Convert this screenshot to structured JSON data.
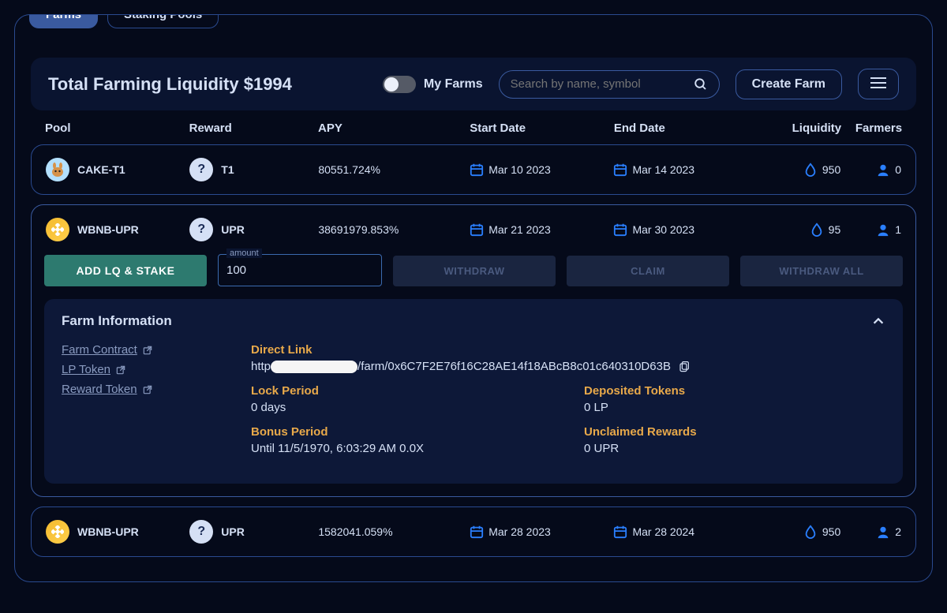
{
  "tabs": {
    "farms": "Farms",
    "staking": "Staking Pools"
  },
  "header": {
    "liquidity_label": "Total Farming Liquidity",
    "liquidity_value": "$1994",
    "my_farms": "My Farms",
    "search_placeholder": "Search by name, symbol",
    "create_farm": "Create Farm"
  },
  "columns": {
    "pool": "Pool",
    "reward": "Reward",
    "apy": "APY",
    "start": "Start Date",
    "end": "End Date",
    "liquidity": "Liquidity",
    "farmers": "Farmers"
  },
  "rows": [
    {
      "pool_icon": "cake",
      "pool": "CAKE-T1",
      "reward_icon": "unknown",
      "reward": "T1",
      "apy": "80551.724%",
      "start": "Mar 10 2023",
      "end": "Mar 14 2023",
      "liquidity": "950",
      "farmers": "0",
      "expanded": false
    },
    {
      "pool_icon": "wbnb",
      "pool": "WBNB-UPR",
      "reward_icon": "unknown",
      "reward": "UPR",
      "apy": "38691979.853%",
      "start": "Mar 21 2023",
      "end": "Mar 30 2023",
      "liquidity": "95",
      "farmers": "1",
      "expanded": true
    },
    {
      "pool_icon": "wbnb",
      "pool": "WBNB-UPR",
      "reward_icon": "unknown",
      "reward": "UPR",
      "apy": "1582041.059%",
      "start": "Mar 28 2023",
      "end": "Mar 28 2024",
      "liquidity": "950",
      "farmers": "2",
      "expanded": false
    }
  ],
  "actions": {
    "add_stake": "ADD LQ & STAKE",
    "amount_label": "amount",
    "amount_value": "100",
    "withdraw": "WITHDRAW",
    "claim": "CLAIM",
    "withdraw_all": "WITHDRAW ALL"
  },
  "info": {
    "title": "Farm Information",
    "links": {
      "contract": "Farm Contract",
      "lp": "LP Token",
      "reward": "Reward Token"
    },
    "direct_link_label": "Direct Link",
    "direct_link_prefix": "http",
    "direct_link_suffix": "/farm/0x6C7F2E76f16C28AE14f18ABcB8c01c640310D63B",
    "lock_label": "Lock Period",
    "lock_value": "0 days",
    "deposited_label": "Deposited Tokens",
    "deposited_value": "0 LP",
    "bonus_label": "Bonus Period",
    "bonus_value": "Until 11/5/1970, 6:03:29 AM 0.0X",
    "unclaimed_label": "Unclaimed Rewards",
    "unclaimed_value": "0 UPR"
  }
}
